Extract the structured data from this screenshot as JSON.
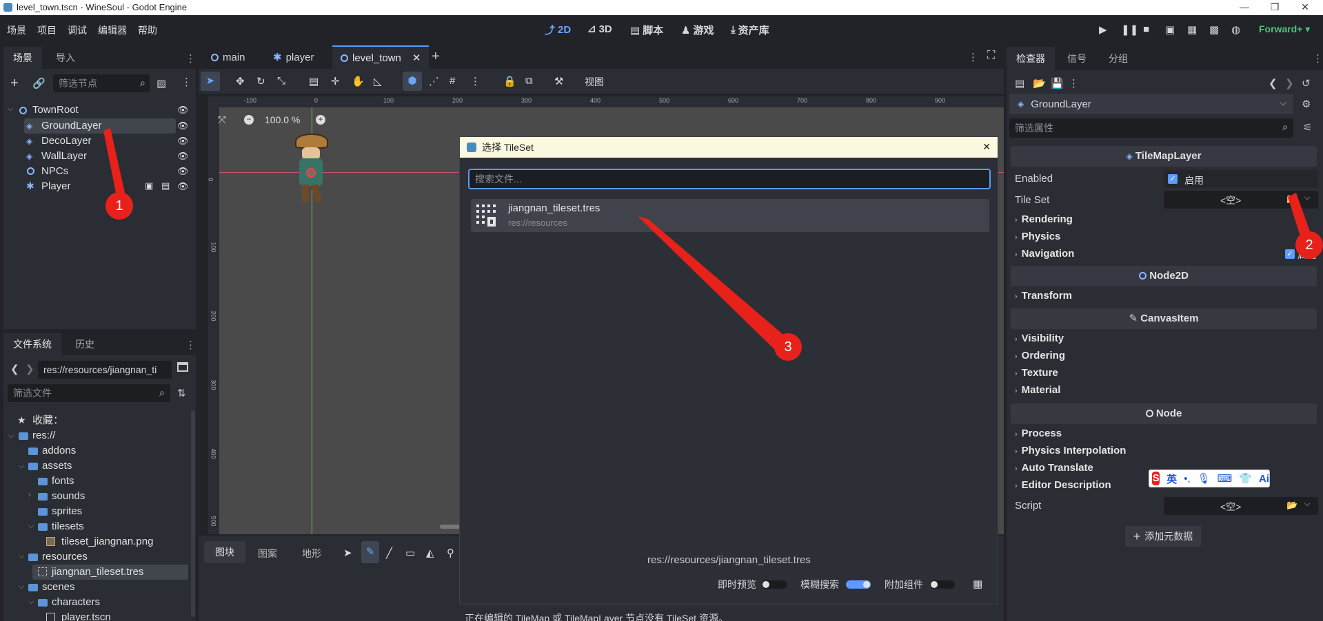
{
  "window": {
    "title": "level_town.tscn - WineSoul - Godot Engine"
  },
  "menu": [
    "场景",
    "项目",
    "调试",
    "编辑器",
    "帮助"
  ],
  "workspaces": [
    "2D",
    "3D",
    "脚本",
    "游戏",
    "资产库"
  ],
  "renderer": "Forward+",
  "scene_dock": {
    "tabs": [
      "场景",
      "导入"
    ],
    "filter_placeholder": "筛选节点",
    "nodes": [
      "TownRoot",
      "GroundLayer",
      "DecoLayer",
      "WallLayer",
      "NPCs",
      "Player"
    ]
  },
  "file_dock": {
    "tabs": [
      "文件系统",
      "历史"
    ],
    "path": "res://resources/jiangnan_ti",
    "filter_placeholder": "筛选文件",
    "favorites": "收藏：",
    "items": [
      "res://",
      "addons",
      "assets",
      "fonts",
      "sounds",
      "sprites",
      "tilesets",
      "tileset_jiangnan.png",
      "resources",
      "jiangnan_tileset.tres",
      "scenes",
      "characters",
      "player.tscn"
    ]
  },
  "editor_tabs": [
    "main",
    "player",
    "level_town"
  ],
  "toolbar": {
    "view_label": "视图"
  },
  "zoom": "100.0 %",
  "ruler_x": [
    "-100",
    "0",
    "100",
    "200",
    "300",
    "400",
    "500",
    "600",
    "700",
    "800",
    "900"
  ],
  "ruler_y": [
    "0",
    "100",
    "200",
    "300",
    "400",
    "500"
  ],
  "bottom_panel": {
    "tabs": [
      "图块",
      "图案",
      "地形"
    ],
    "status": "正在编辑的 TileMap 或 TileMapLayer 节点没有 TileSet 资源。"
  },
  "dialog": {
    "title": "选择 TileSet",
    "search_placeholder": "搜索文件...",
    "result_name": "jiangnan_tileset.tres",
    "result_path": "res://resources",
    "selected_path": "res://resources/jiangnan_tileset.tres",
    "toggles": [
      {
        "label": "即时预览",
        "on": false
      },
      {
        "label": "模糊搜索",
        "on": true
      },
      {
        "label": "附加组件",
        "on": false
      }
    ]
  },
  "inspector": {
    "tabs": [
      "检查器",
      "信号",
      "分组"
    ],
    "node": "GroundLayer",
    "filter_placeholder": "筛选属性",
    "section_tilemaplayer": "TileMapLayer",
    "enabled_label": "Enabled",
    "enabled_value": "启用",
    "tileset_label": "Tile Set",
    "empty_value": "<空>",
    "groups1": [
      "Rendering",
      "Physics",
      "Navigation"
    ],
    "navigation_value": "启用",
    "section_node2d": "Node2D",
    "groups2": [
      "Transform"
    ],
    "section_canvasitem": "CanvasItem",
    "groups3": [
      "Visibility",
      "Ordering",
      "Texture",
      "Material"
    ],
    "section_node": "Node",
    "groups4": [
      "Process",
      "Physics Interpolation",
      "Auto Translate",
      "Editor Description"
    ],
    "script_label": "Script",
    "add_metadata": "添加元数据"
  },
  "ime": {
    "lang": "英",
    "ai": "Ai"
  },
  "annotations": [
    "1",
    "2",
    "3"
  ],
  "colors": {
    "accent": "#5a9cff",
    "arrow": "#e8211a",
    "bg": "#212329",
    "panel": "#2a2d33"
  }
}
